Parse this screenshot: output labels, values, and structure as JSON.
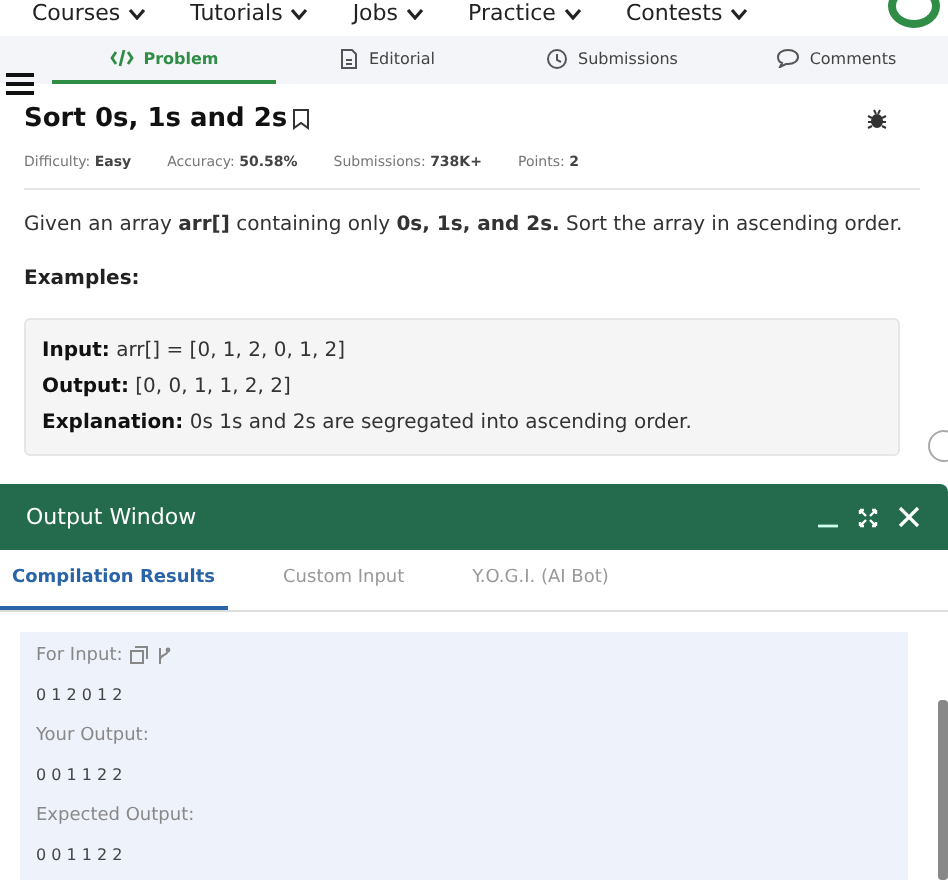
{
  "nav": [
    {
      "label": "Courses"
    },
    {
      "label": "Tutorials"
    },
    {
      "label": "Jobs"
    },
    {
      "label": "Practice"
    },
    {
      "label": "Contests"
    }
  ],
  "tabs": [
    {
      "label": "Problem",
      "selected": true
    },
    {
      "label": "Editorial",
      "selected": false
    },
    {
      "label": "Submissions",
      "selected": false
    },
    {
      "label": "Comments",
      "selected": false
    }
  ],
  "problem": {
    "title": "Sort 0s, 1s and 2s",
    "meta": [
      {
        "label": "Difficulty:",
        "value": "Easy"
      },
      {
        "label": "Accuracy:",
        "value": "50.58%"
      },
      {
        "label": "Submissions:",
        "value": "738K+"
      },
      {
        "label": "Points:",
        "value": "2"
      }
    ],
    "description": "Given an array **arr[]** containing only **0s, 1s, and 2s.** Sort the array in ascending order.",
    "examples_heading": "Examples:",
    "example": [
      {
        "label": "Input:",
        "value": "arr[] = [0, 1, 2, 0, 1, 2]"
      },
      {
        "label": "Output:",
        "value": "[0, 0, 1, 1, 2, 2]"
      },
      {
        "label": "Explanation:",
        "value": "0s 1s and 2s are segregated into ascending order."
      }
    ]
  },
  "output_window": {
    "title": "Output Window",
    "tabs": [
      {
        "label": "Compilation Results",
        "selected": true
      },
      {
        "label": "Custom Input",
        "selected": false
      },
      {
        "label": "Y.O.G.I. (AI Bot)",
        "selected": false
      }
    ],
    "results": [
      {
        "kind": "label-tools",
        "text": "For Input:"
      },
      {
        "kind": "value",
        "text": "0 1 2 0 1 2"
      },
      {
        "kind": "label",
        "text": "Your Output:"
      },
      {
        "kind": "value",
        "text": "0 0 1 1 2 2"
      },
      {
        "kind": "label",
        "text": "Expected Output:"
      },
      {
        "kind": "value",
        "text": "0 0 1 1 2 2"
      }
    ]
  }
}
